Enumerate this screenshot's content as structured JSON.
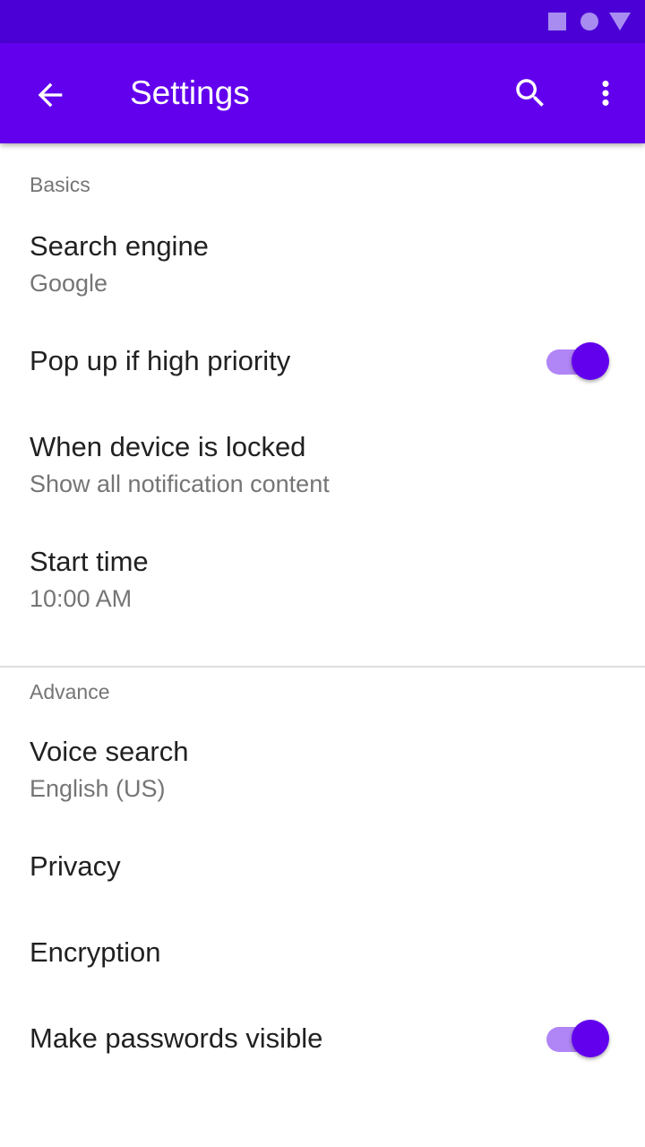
{
  "app_bar": {
    "title": "Settings",
    "color": "#6200ee",
    "status_bar_color": "#4b00d6"
  },
  "icons": {
    "back": "arrow-back-icon",
    "search": "search-icon",
    "more": "more-vert-icon"
  },
  "sections": {
    "basics": {
      "header": "Basics",
      "search_engine": {
        "title": "Search engine",
        "summary": "Google"
      },
      "popup_priority": {
        "title": "Pop up if high priority",
        "enabled": true
      },
      "device_locked": {
        "title": "When device is locked",
        "summary": "Show all notification content"
      },
      "start_time": {
        "title": "Start time",
        "summary": "10:00 AM"
      }
    },
    "advance": {
      "header": "Advance",
      "voice_search": {
        "title": "Voice search",
        "summary": "English (US)"
      },
      "privacy": {
        "title": "Privacy"
      },
      "encryption": {
        "title": "Encryption"
      },
      "passwords_visible": {
        "title": "Make passwords visible",
        "enabled": true
      }
    }
  }
}
